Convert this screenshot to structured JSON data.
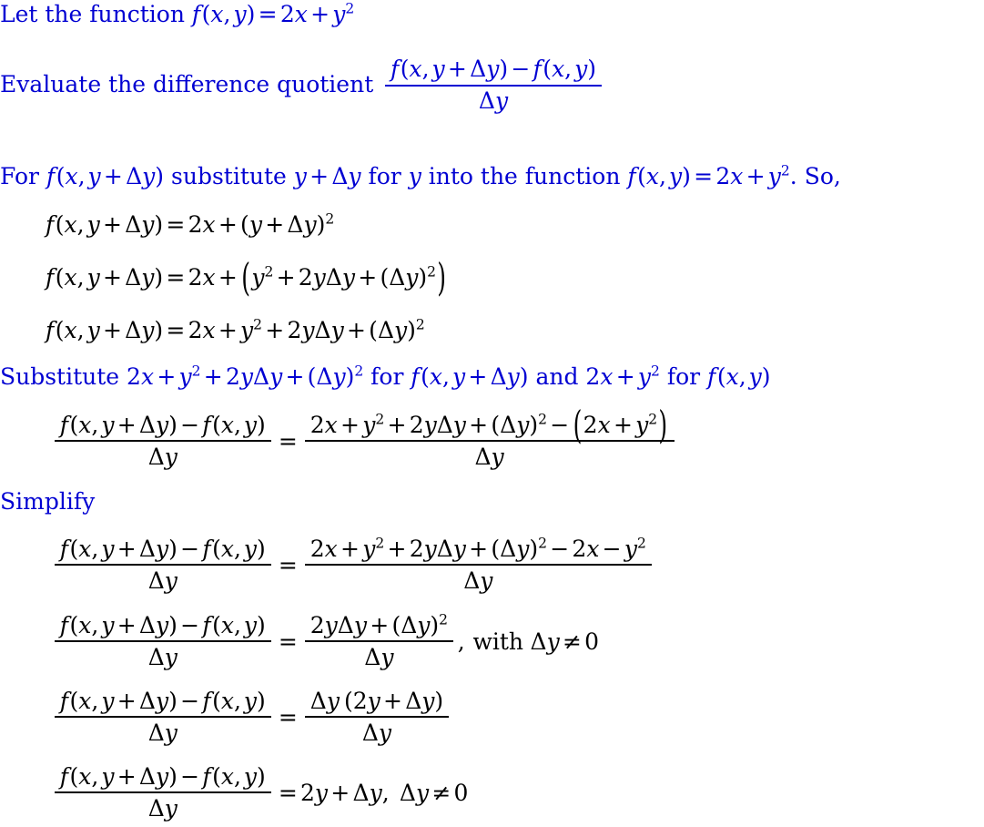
{
  "document": {
    "type": "math-worked-solution",
    "topic": "difference quotient of a two-variable function",
    "colors": {
      "prose": "#0000d2",
      "equation": "#000000",
      "background": "#ffffff"
    }
  },
  "line1": {
    "text_before": "Let the function ",
    "math": "f (x, y) = 2x + y2",
    "f": "f",
    "lparen": "(",
    "x": "x",
    "comma": ",",
    "y": "y",
    "rparen": ")",
    "eq": "=",
    "two": "2",
    "plus": "+",
    "exp2": "2"
  },
  "line2": {
    "text_before": "Evaluate the difference quotient ",
    "numerator": "f (x, y + Δy) − f (x, y)",
    "denominator": "Δy",
    "delta": "Δ",
    "minus": "−"
  },
  "line3": {
    "part1": "For ",
    "math1": "f (x, y + Δy)",
    "part2": " substitute ",
    "math2": "y + Δy",
    "part3": " for ",
    "math3": "y",
    "part4": " into the function ",
    "math4": "f (x, y) = 2x + y2",
    "part5": ". So,"
  },
  "eq1": {
    "lhs": "f (x, y + Δy)",
    "eq": "=",
    "rhs": "2x + (y + Δy)2"
  },
  "eq2": {
    "lhs": "f (x, y + Δy)",
    "eq": "=",
    "rhs": "2x + (y2 + 2yΔy + (Δy)2)"
  },
  "eq3": {
    "lhs": "f (x, y + Δy)",
    "eq": "=",
    "rhs": "2x + y2 + 2yΔy + (Δy)2"
  },
  "line4": {
    "part1": "Substitute ",
    "math1": "2x + y2 + 2yΔy + (Δy)2",
    "part2": " for ",
    "math2": "f (x, y + Δy)",
    "part3": " and ",
    "math3": "2x + y2",
    "part4": " for ",
    "math4": "f (x, y)"
  },
  "eq4": {
    "lhs_num": "f (x, y + Δy) − f (x, y)",
    "lhs_den": "Δy",
    "eq": "=",
    "rhs_num": "2x + y2 + 2yΔy + (Δy)2 − (2x + y2)",
    "rhs_den": "Δy"
  },
  "line5": {
    "text": "Simplify"
  },
  "eq5": {
    "lhs_num": "f (x, y + Δy) − f (x, y)",
    "lhs_den": "Δy",
    "eq": "=",
    "rhs_num": "2x + y2 + 2yΔy + (Δy)2 − 2x − y2",
    "rhs_den": "Δy"
  },
  "eq6": {
    "lhs_num": "f (x, y + Δy) − f (x, y)",
    "lhs_den": "Δy",
    "eq": "=",
    "rhs_num": "2yΔy + (Δy)2",
    "rhs_den": "Δy",
    "trailing_comma": ",",
    "condition_word": "with",
    "condition": "Δy ≠ 0",
    "neq": "≠",
    "zero": "0"
  },
  "eq7": {
    "lhs_num": "f (x, y + Δy) − f (x, y)",
    "lhs_den": "Δy",
    "eq": "=",
    "rhs_num": "Δy (2y + Δy)",
    "rhs_den": "Δy"
  },
  "eq8": {
    "lhs_num": "f (x, y + Δy) − f (x, y)",
    "lhs_den": "Δy",
    "eq": "=",
    "rhs": "2y + Δy, Δy ≠ 0"
  },
  "symbols": {
    "delta": "Δ",
    "minus": "−",
    "plus": "+",
    "equals": "=",
    "neq": "≠",
    "lparen": "(",
    "rparen": ")",
    "comma": ",",
    "two": "2",
    "zero": "0",
    "f": "f",
    "x": "x",
    "y": "y"
  }
}
